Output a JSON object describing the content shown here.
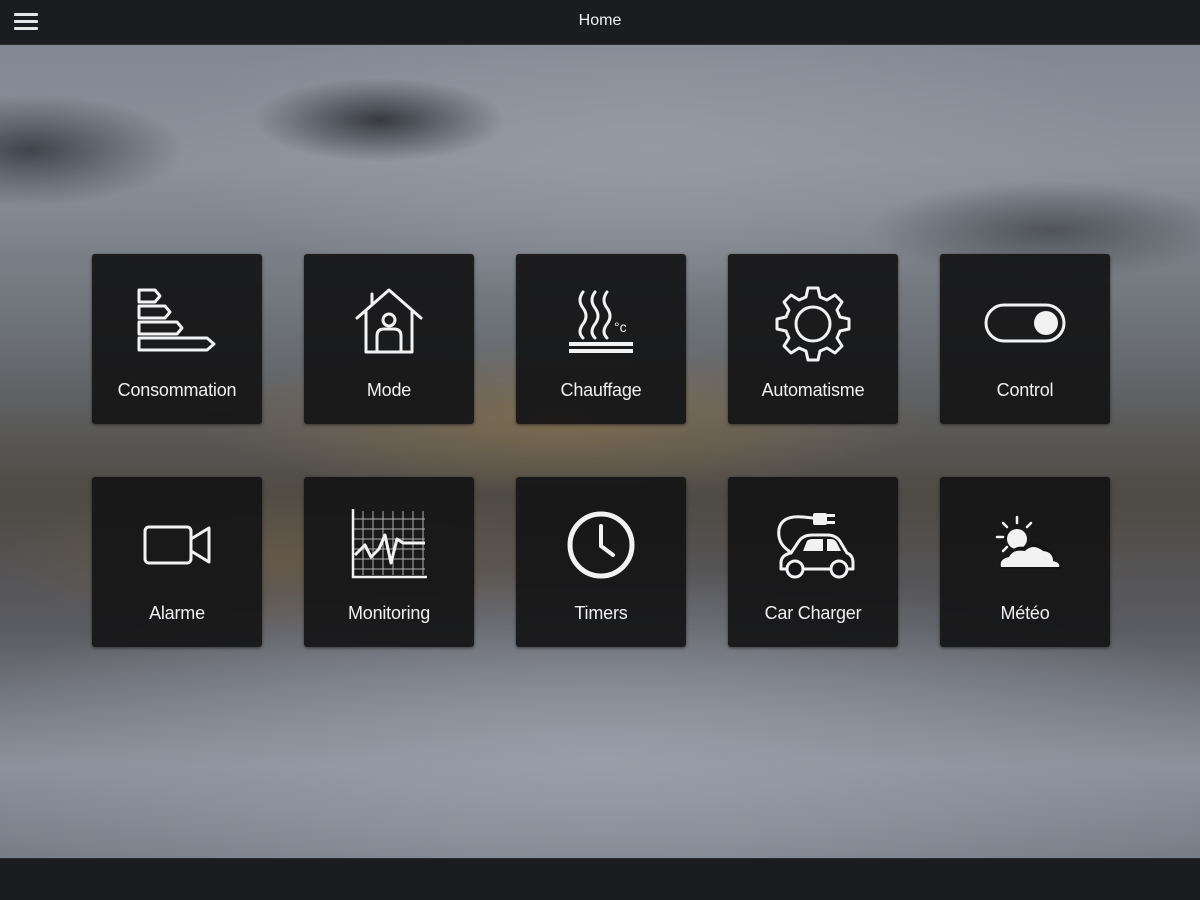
{
  "header": {
    "title": "Home",
    "menu_icon": "hamburger-menu-icon"
  },
  "tiles": [
    {
      "label": "Consommation",
      "icon": "energy-rating-icon"
    },
    {
      "label": "Mode",
      "icon": "home-person-icon"
    },
    {
      "label": "Chauffage",
      "icon": "heating-celsius-icon"
    },
    {
      "label": "Automatisme",
      "icon": "gear-icon"
    },
    {
      "label": "Control",
      "icon": "toggle-switch-icon"
    },
    {
      "label": "Alarme",
      "icon": "video-camera-icon"
    },
    {
      "label": "Monitoring",
      "icon": "monitoring-graph-icon"
    },
    {
      "label": "Timers",
      "icon": "clock-icon"
    },
    {
      "label": "Car Charger",
      "icon": "electric-car-icon"
    },
    {
      "label": "Météo",
      "icon": "weather-sun-cloud-icon"
    }
  ],
  "icon_glyphs": {
    "heating_unit": "°c"
  },
  "colors": {
    "bar": "#1b1c1f",
    "tile": "#141416",
    "text": "#f0f0f0"
  }
}
